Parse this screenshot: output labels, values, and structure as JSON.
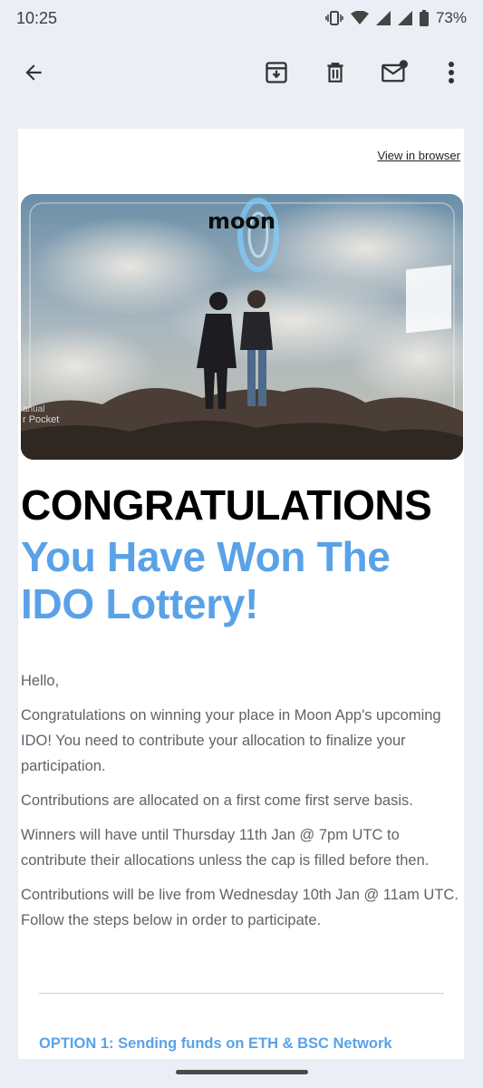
{
  "status_bar": {
    "time": "10:25",
    "battery": "73%",
    "icons": [
      "vibrate-icon",
      "wifi-icon",
      "signal-icon",
      "signal-icon",
      "battery-icon"
    ]
  },
  "toolbar": {
    "icons": [
      "back-arrow-icon",
      "archive-icon",
      "delete-icon",
      "mark-unread-icon",
      "more-vert-icon"
    ]
  },
  "email": {
    "view_in_browser": "View in browser",
    "hero": {
      "logo_text": "moon",
      "side_text_1": "r Pocket",
      "side_text_2": "anual"
    },
    "headline": "CONGRATULATIONS",
    "subheadline": "You Have Won The IDO Lottery!",
    "paragraphs": [
      "Hello,",
      "Congratulations on winning your place in Moon App's upcoming IDO! You need to contribute your allocation to finalize your participation.",
      "Contributions are allocated on a first come first serve basis.",
      "Winners will have until Thursday 11th Jan @ 7pm UTC to contribute their allocations unless the cap is filled before then.",
      "Contributions will be live from Wednesday 10th Jan @ 11am UTC. Follow the steps below in order to participate."
    ],
    "option_1": "OPTION 1: Sending funds on ETH & BSC Network"
  },
  "colors": {
    "background": "#eceef6",
    "accent_blue": "#5aa2e8",
    "body_text": "#5f6368"
  }
}
